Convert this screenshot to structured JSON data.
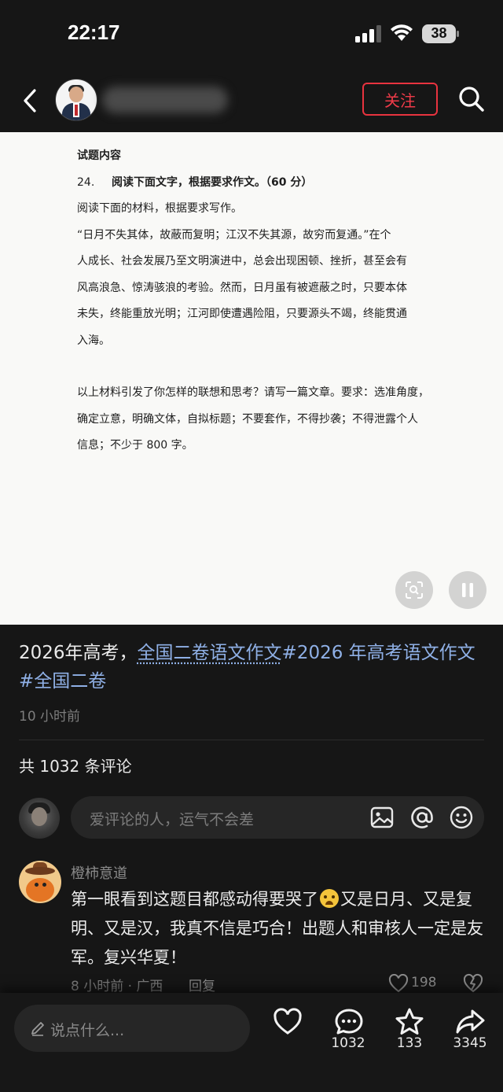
{
  "status_bar": {
    "time": "22:17",
    "battery": "38"
  },
  "nav": {
    "follow_label": "关注"
  },
  "document": {
    "title": "试题内容",
    "question_number": "24.",
    "question_title": "阅读下面文字，根据要求作文。（60 分）",
    "intro": "阅读下面的材料，根据要求写作。",
    "material_lines": [
      "“日月不失其体，故蔽而复明；江汉不失其源，故穷而复通。”在个",
      "人成长、社会发展乃至文明演进中，总会出现困顿、挫折，甚至会有",
      "风高浪急、惊涛骇浪的考验。然而，日月虽有被遮蔽之时，只要本体",
      "未失，终能重放光明；江河即使遭遇险阻，只要源头不竭，终能贯通",
      "入海。"
    ],
    "requirement_lines": [
      "以上材料引发了你怎样的联想和思考？请写一篇文章。要求：选准角度，",
      "确定立意，明确文体，自拟标题；不要套作，不得抄袭；不得泄露个人",
      "信息；不少于 800 字。"
    ]
  },
  "caption": {
    "prefix": "2026年高考，",
    "link1": "全国二卷语文作文",
    "tag1": "#2026 年高考语文作文",
    "tag2": "#全国二卷",
    "time": "10 小时前"
  },
  "comments_header": "共 1032 条评论",
  "comment_input": {
    "placeholder": "爱评论的人，运气不会差"
  },
  "comment": {
    "author": "橙柿意道",
    "text_before_emoji": "第一眼看到这题目都感动得要哭了",
    "text_after_emoji": "又是日月、又是复明、又是汉，我真不信是巧合！出题人和审核人一定是友军。复兴华夏！",
    "meta": "8 小时前 · 广西",
    "reply_label": "回复",
    "likes": "198"
  },
  "bottom_bar": {
    "say_placeholder": "说点什么...",
    "comment_count": "1032",
    "star_count": "133",
    "share_count": "3345"
  },
  "icons": [
    "back-icon",
    "search-icon",
    "scan-icon",
    "pause-icon",
    "image-icon",
    "at-icon",
    "emoji-icon",
    "heart-icon",
    "comment-icon",
    "star-icon",
    "share-icon",
    "pen-icon",
    "dislike-icon"
  ],
  "colors": {
    "accent_red": "#ef3b49",
    "link_blue": "#8fb0e6",
    "background": "#161616"
  }
}
